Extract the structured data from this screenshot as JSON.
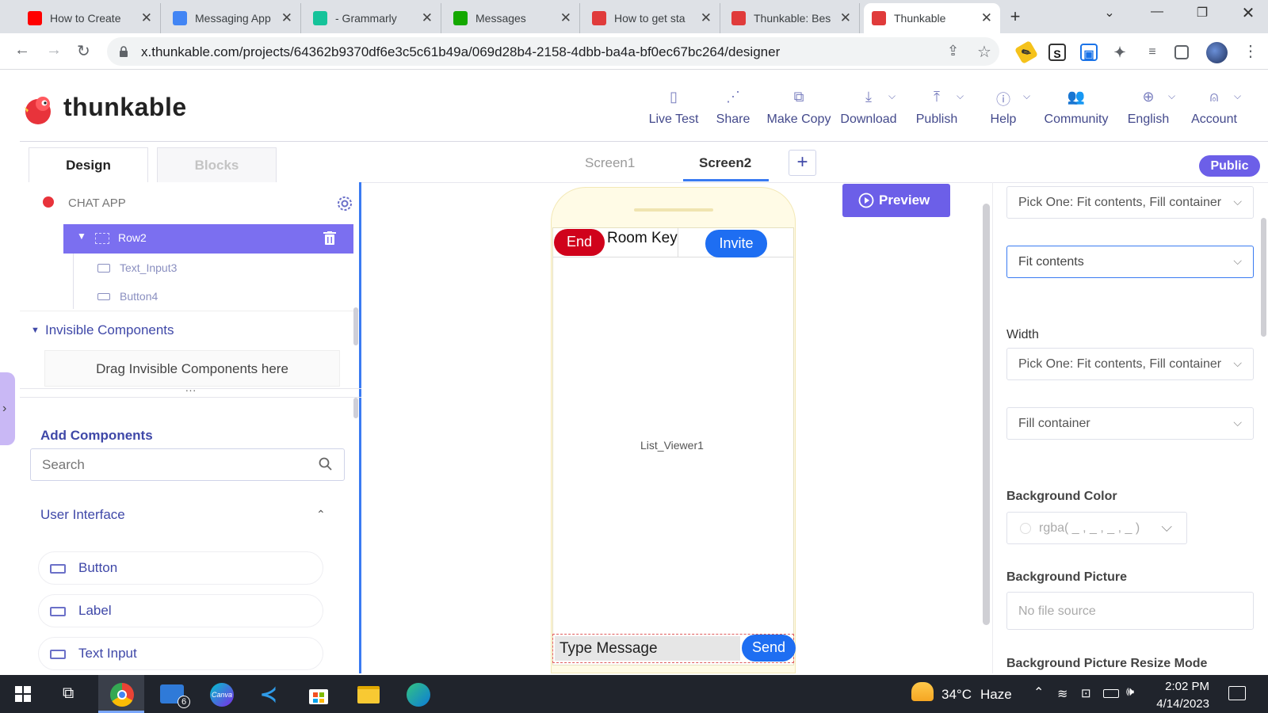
{
  "browser": {
    "tabs": [
      {
        "title": "How to Create",
        "favicon_color": "#ff0000",
        "icon": "youtube-icon"
      },
      {
        "title": "Messaging App",
        "favicon_color": "#4285f4",
        "icon": "docs-icon"
      },
      {
        "title": "- Grammarly",
        "favicon_color": "#15c39a",
        "icon": "grammarly-icon"
      },
      {
        "title": "Messages",
        "favicon_color": "#14a800",
        "icon": "upwork-icon"
      },
      {
        "title": "How to get sta",
        "favicon_color": "#e03b3b",
        "icon": "thunkable-icon"
      },
      {
        "title": "Thunkable: Bes",
        "favicon_color": "#e03b3b",
        "icon": "thunkable-icon"
      },
      {
        "title": "Thunkable",
        "favicon_color": "#e03b3b",
        "icon": "thunkable-icon"
      }
    ],
    "url": "x.thunkable.com/projects/64362b9370df6e3c5c61b49a/069d28b4-2158-4dbb-ba4a-bf0ec67bc264/designer"
  },
  "header": {
    "logo_text": "thunkable",
    "nav": [
      {
        "label": "Live Test",
        "icon": "phone-icon",
        "dropdown": false
      },
      {
        "label": "Share",
        "icon": "share-icon",
        "dropdown": false
      },
      {
        "label": "Make Copy",
        "icon": "copy-icon",
        "dropdown": false
      },
      {
        "label": "Download",
        "icon": "download-icon",
        "dropdown": true
      },
      {
        "label": "Publish",
        "icon": "upload-icon",
        "dropdown": true
      },
      {
        "label": "Help",
        "icon": "info-icon",
        "dropdown": true
      },
      {
        "label": "Community",
        "icon": "people-icon",
        "dropdown": false
      },
      {
        "label": "English",
        "icon": "globe-icon",
        "dropdown": true
      },
      {
        "label": "Account",
        "icon": "user-icon",
        "dropdown": true
      }
    ]
  },
  "left": {
    "tab_design": "Design",
    "tab_blocks": "Blocks",
    "project_name": "CHAT APP",
    "tree": {
      "row": "Row2",
      "child1": "Text_Input3",
      "child2": "Button4"
    },
    "invisible_title": "Invisible Components",
    "invisible_drop": "Drag Invisible Components here",
    "add_components": "Add Components",
    "search_placeholder": "Search",
    "ui_section": "User Interface",
    "components": [
      "Button",
      "Label",
      "Text Input"
    ]
  },
  "center": {
    "screen1": "Screen1",
    "screen2": "Screen2",
    "public_badge": "Public",
    "preview": "Preview",
    "phone": {
      "end": "End",
      "room_key": "Room Key",
      "invite": "Invite",
      "list_viewer": "List_Viewer1",
      "message_placeholder": "Type Message",
      "send": "Send"
    }
  },
  "right": {
    "height_pick": "Pick One: Fit contents, Fill container",
    "height_value": "Fit contents",
    "width_label": "Width",
    "width_pick": "Pick One: Fit contents, Fill container",
    "width_value": "Fill container",
    "bg_color_label": "Background Color",
    "bg_color_value": "rgba( _ , _ , _ , _ )",
    "bg_picture_label": "Background Picture",
    "bg_picture_value": "No file source",
    "bg_resize_label": "Background Picture Resize Mode"
  },
  "taskbar": {
    "weather_temp": "34°C",
    "weather_desc": "Haze",
    "time": "2:02 PM",
    "date": "4/14/2023",
    "mail_badge": "6"
  },
  "colors": {
    "accent": "#6c5fe8",
    "brand_red": "#d0021b",
    "blue": "#1e6ef2",
    "nav_text": "#444a8c"
  }
}
